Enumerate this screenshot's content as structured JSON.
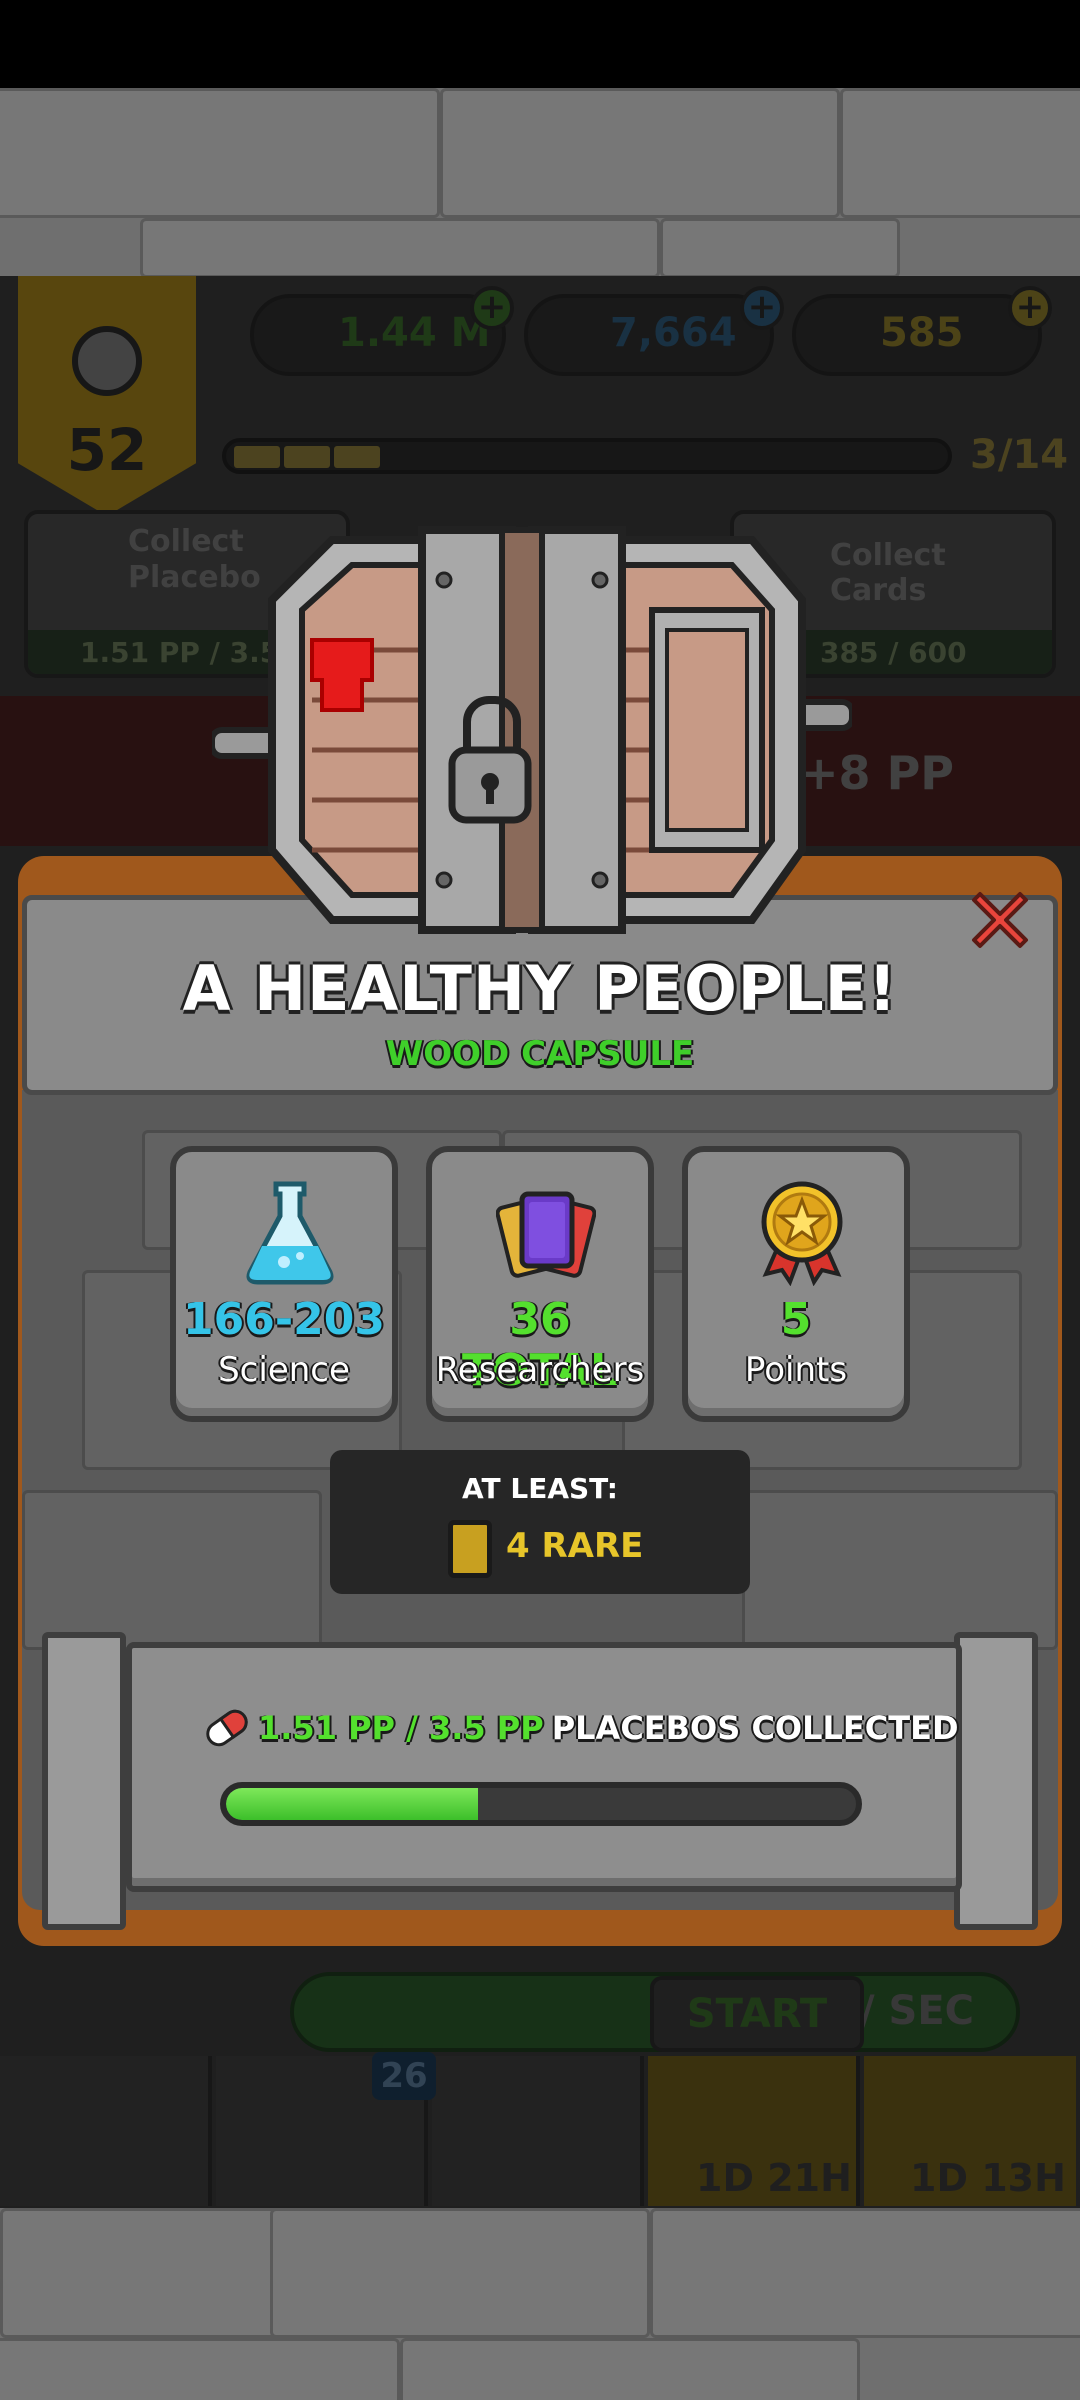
{
  "game_hud": {
    "level": "52",
    "currencies": [
      {
        "name": "money",
        "value": "1.44 M",
        "color": "#3a6a2a"
      },
      {
        "name": "science",
        "value": "7,664",
        "color": "#2e5a7a"
      },
      {
        "name": "gold",
        "value": "585",
        "color": "#8a7a2a"
      }
    ],
    "xp_progress": "3/14",
    "cards": [
      {
        "title_line1": "Collect",
        "title_line2": "Placebo",
        "progress": "1.51 PP / 3.5"
      },
      {
        "title_line1": "Collect Cards",
        "progress": "385 / 600"
      }
    ],
    "income": "+8 PP",
    "start_label": "START",
    "per_sec": "/ SEC",
    "badge_count": "26",
    "timers": [
      "1D 21H",
      "1D 13H"
    ]
  },
  "modal": {
    "title": "A HEALTHY PEOPLE!",
    "subtitle": "WOOD CAPSULE",
    "stats": [
      {
        "value": "166-203",
        "label": "Science",
        "color": "#35c4e8",
        "icon": "flask-icon"
      },
      {
        "value": "36 TOTAL",
        "label": "Researchers",
        "color": "#54e02e",
        "icon": "cards-icon"
      },
      {
        "value": "5",
        "label": "Points",
        "color": "#54e02e",
        "icon": "medal-icon"
      }
    ],
    "guarantee": {
      "label": "AT LEAST:",
      "rarity": "4 RARE",
      "rarity_color": "#e7c52a"
    },
    "progress": {
      "amount": "1.51 PP / 3.5 PP",
      "label": "PLACEBOS COLLECTED",
      "fraction": 0.4
    }
  }
}
